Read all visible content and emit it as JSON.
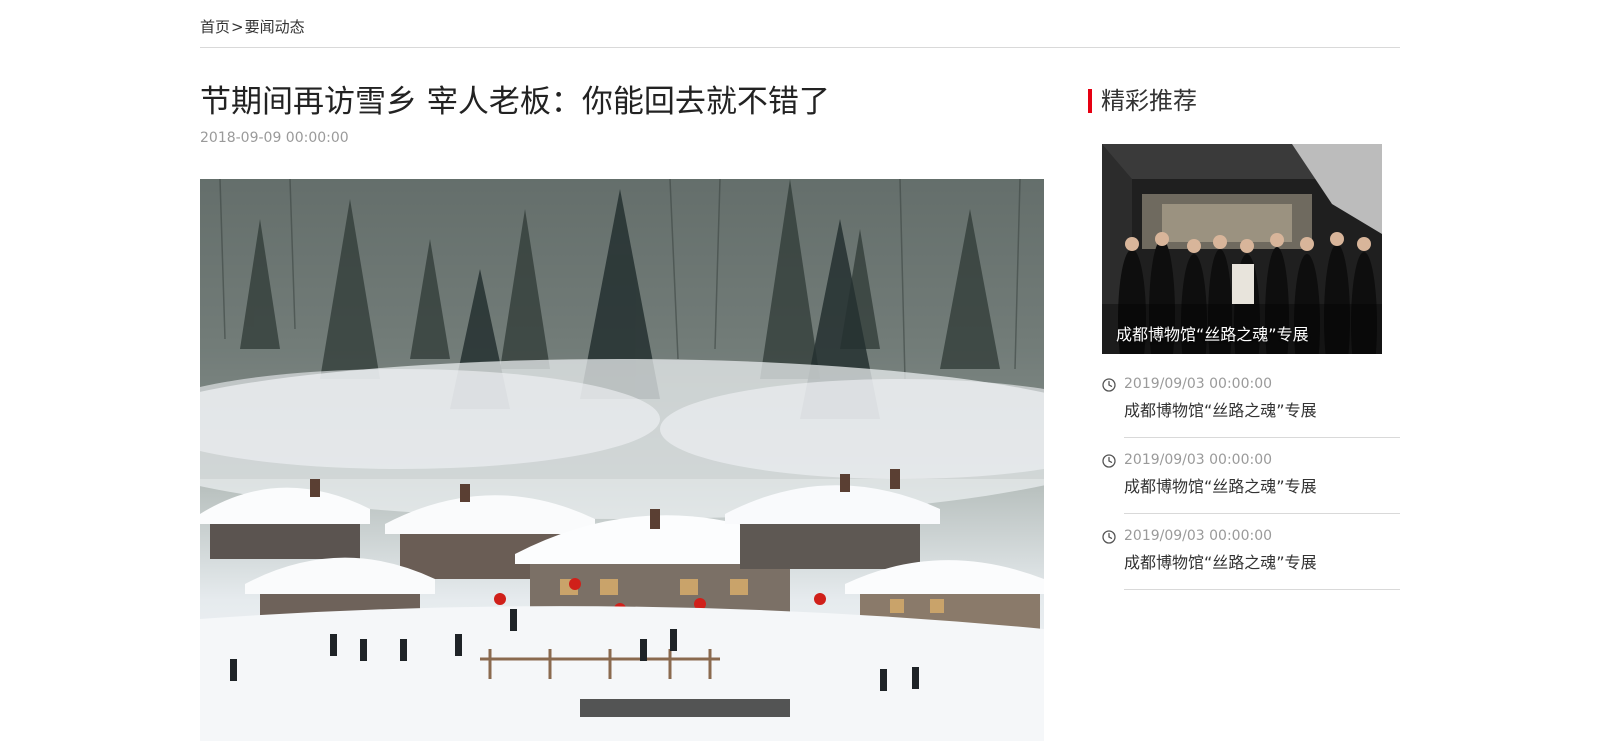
{
  "breadcrumb": {
    "home": "首页",
    "separator": ">",
    "current": "要闻动态"
  },
  "article": {
    "title": "节期间再访雪乡 宰人老板：你能回去就不错了",
    "date": "2018-09-09 00:00:00",
    "hero_image": "snowy-village-photo"
  },
  "sidebar": {
    "heading": "精彩推荐",
    "accent_color": "#e60012",
    "featured": {
      "caption": "成都博物馆“丝路之魂”专展",
      "image": "museum-visit-photo"
    },
    "items": [
      {
        "date": "2019/09/03 00:00:00",
        "title": "成都博物馆“丝路之魂”专展",
        "icon": "clock-icon"
      },
      {
        "date": "2019/09/03 00:00:00",
        "title": "成都博物馆“丝路之魂”专展",
        "icon": "clock-icon"
      },
      {
        "date": "2019/09/03 00:00:00",
        "title": "成都博物馆“丝路之魂”专展",
        "icon": "clock-icon"
      }
    ]
  }
}
